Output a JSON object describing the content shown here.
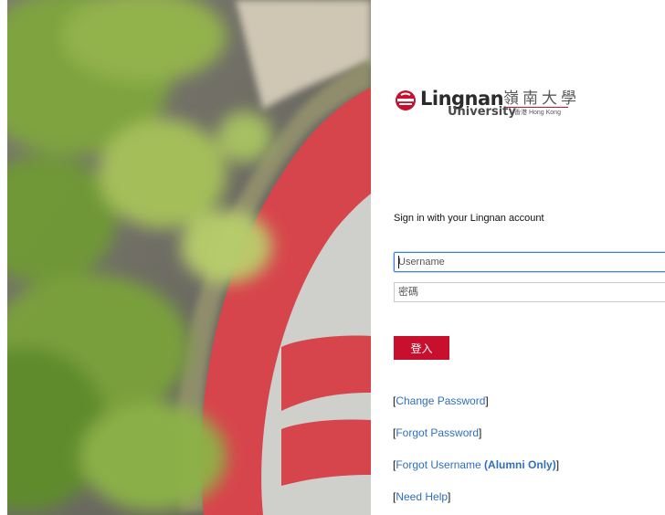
{
  "logo": {
    "wordmark": "Lingnan",
    "chinese": "嶺南大學",
    "university": "University",
    "hong_kong": "香港 Hong Kong"
  },
  "form": {
    "heading": "Sign in with your Lingnan account",
    "username_placeholder": "Username",
    "password_placeholder": "密碼",
    "login_label": "登入"
  },
  "links": [
    {
      "open": "[",
      "label": "Change Password",
      "close": "]"
    },
    {
      "open": "[",
      "label": "Forgot Password",
      "close": "]"
    },
    {
      "open": "[",
      "label": "Forgot Username ",
      "bold": "(Alumni Only)",
      "close": "]"
    },
    {
      "open": "[",
      "label": "Need Help",
      "close": "]"
    }
  ],
  "colors": {
    "brand_red": "#c8102e",
    "link_blue": "#2e6fc0",
    "focus_blue": "#3b7ddd"
  }
}
